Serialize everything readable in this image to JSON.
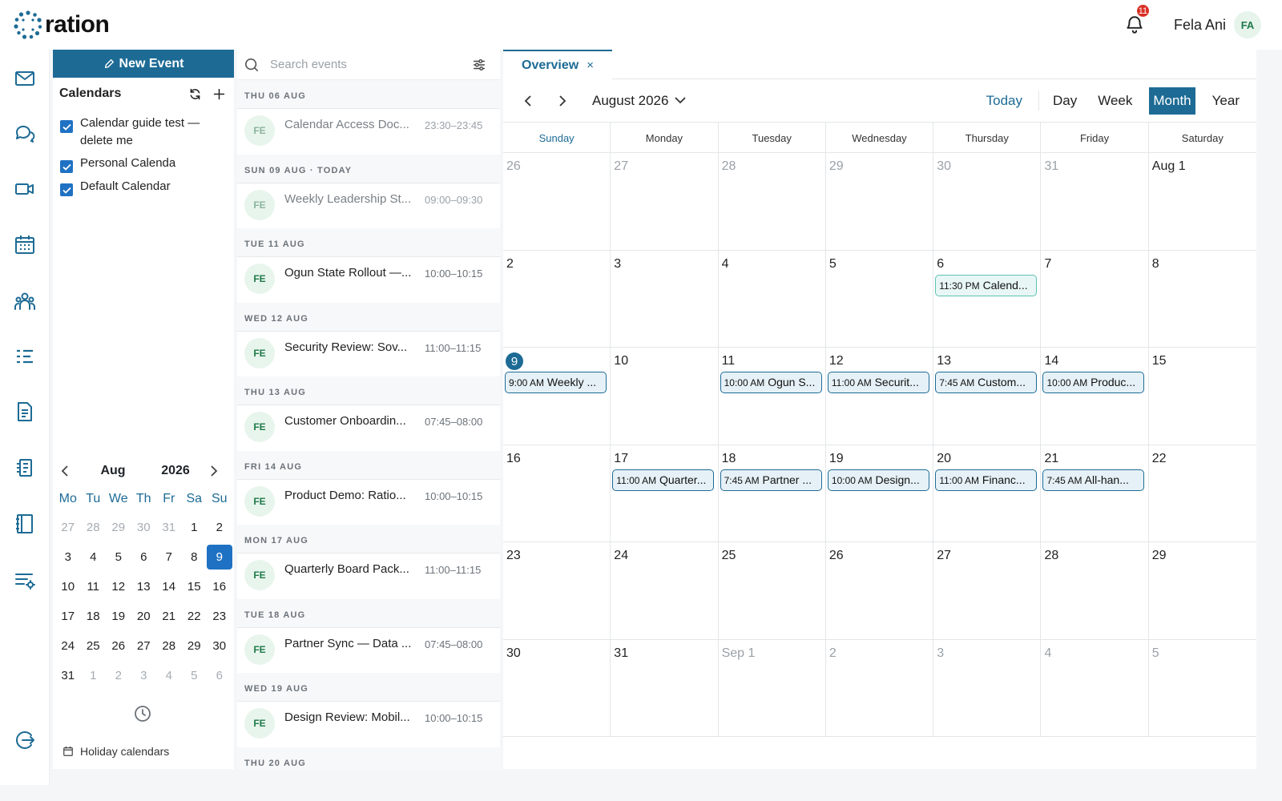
{
  "app": {
    "logo_text": "ration",
    "notifications": "11",
    "user_name": "Fela Ani",
    "user_initials": "FA"
  },
  "sidebar": {
    "new_event": "New Event",
    "calendars_title": "Calendars",
    "calendars": [
      {
        "label": "Calendar guide test — delete me",
        "checked": true
      },
      {
        "label": "Personal Calenda",
        "checked": true
      },
      {
        "label": "Default Calendar",
        "checked": true
      }
    ],
    "mini": {
      "month": "Aug",
      "year": "2026",
      "dows": [
        "Mo",
        "Tu",
        "We",
        "Th",
        "Fr",
        "Sa",
        "Su"
      ],
      "days": [
        "27",
        "28",
        "29",
        "30",
        "31",
        "1",
        "2",
        "3",
        "4",
        "5",
        "6",
        "7",
        "8",
        "9",
        "10",
        "11",
        "12",
        "13",
        "14",
        "15",
        "16",
        "17",
        "18",
        "19",
        "20",
        "21",
        "22",
        "23",
        "24",
        "25",
        "26",
        "27",
        "28",
        "29",
        "30",
        "31",
        "1",
        "2",
        "3",
        "4",
        "5",
        "6"
      ],
      "dim_before": 5,
      "dim_after_from": 36,
      "selected_index": 13
    },
    "holiday_label": "Holiday calendars"
  },
  "event_list": {
    "search_placeholder": "Search events",
    "groups": [
      {
        "date": "THU 06 AUG",
        "events": [
          {
            "avatar": "FE",
            "title": "Calendar Access Doc...",
            "time": "23:30–23:45",
            "past": true
          }
        ]
      },
      {
        "date": "SUN 09 AUG · TODAY",
        "events": [
          {
            "avatar": "FE",
            "title": "Weekly Leadership St...",
            "time": "09:00–09:30",
            "past": true
          }
        ]
      },
      {
        "date": "TUE 11 AUG",
        "events": [
          {
            "avatar": "FE",
            "title": "Ogun State Rollout —...",
            "time": "10:00–10:15",
            "past": false
          }
        ]
      },
      {
        "date": "WED 12 AUG",
        "events": [
          {
            "avatar": "FE",
            "title": "Security Review: Sov...",
            "time": "11:00–11:15",
            "past": false
          }
        ]
      },
      {
        "date": "THU 13 AUG",
        "events": [
          {
            "avatar": "FE",
            "title": "Customer Onboardin...",
            "time": "07:45–08:00",
            "past": false
          }
        ]
      },
      {
        "date": "FRI 14 AUG",
        "events": [
          {
            "avatar": "FE",
            "title": "Product Demo: Ratio...",
            "time": "10:00–10:15",
            "past": false
          }
        ]
      },
      {
        "date": "MON 17 AUG",
        "events": [
          {
            "avatar": "FE",
            "title": "Quarterly Board Pack...",
            "time": "11:00–11:15",
            "past": false
          }
        ]
      },
      {
        "date": "TUE 18 AUG",
        "events": [
          {
            "avatar": "FE",
            "title": "Partner Sync — Data ...",
            "time": "07:45–08:00",
            "past": false
          }
        ]
      },
      {
        "date": "WED 19 AUG",
        "events": [
          {
            "avatar": "FE",
            "title": "Design Review: Mobil...",
            "time": "10:00–10:15",
            "past": false
          }
        ]
      },
      {
        "date": "THU 20 AUG",
        "events": []
      }
    ]
  },
  "main": {
    "tab_label": "Overview",
    "tab_close": "×",
    "month_label": "August 2026",
    "today_label": "Today",
    "views": [
      "Day",
      "Week",
      "Month",
      "Year"
    ],
    "active_view": "Month",
    "weekdays": [
      "Sunday",
      "Monday",
      "Tuesday",
      "Wednesday",
      "Thursday",
      "Friday",
      "Saturday"
    ],
    "cells": [
      {
        "label": "26",
        "dim": true
      },
      {
        "label": "27",
        "dim": true
      },
      {
        "label": "28",
        "dim": true
      },
      {
        "label": "29",
        "dim": true
      },
      {
        "label": "30",
        "dim": true
      },
      {
        "label": "31",
        "dim": true
      },
      {
        "label": "Aug 1"
      },
      {
        "label": "2"
      },
      {
        "label": "3"
      },
      {
        "label": "4"
      },
      {
        "label": "5"
      },
      {
        "label": "6",
        "event": {
          "time": "11:30 PM",
          "title": "Calend...",
          "past": true
        }
      },
      {
        "label": "7"
      },
      {
        "label": "8"
      },
      {
        "label": "9",
        "today": true,
        "event": {
          "time": "9:00 AM",
          "title": "Weekly ..."
        }
      },
      {
        "label": "10"
      },
      {
        "label": "11",
        "event": {
          "time": "10:00 AM",
          "title": "Ogun S..."
        }
      },
      {
        "label": "12",
        "event": {
          "time": "11:00 AM",
          "title": "Securit..."
        }
      },
      {
        "label": "13",
        "event": {
          "time": "7:45 AM",
          "title": "Custom..."
        }
      },
      {
        "label": "14",
        "event": {
          "time": "10:00 AM",
          "title": "Produc..."
        }
      },
      {
        "label": "15"
      },
      {
        "label": "16"
      },
      {
        "label": "17",
        "event": {
          "time": "11:00 AM",
          "title": "Quarter..."
        }
      },
      {
        "label": "18",
        "event": {
          "time": "7:45 AM",
          "title": "Partner ..."
        }
      },
      {
        "label": "19",
        "event": {
          "time": "10:00 AM",
          "title": "Design..."
        }
      },
      {
        "label": "20",
        "event": {
          "time": "11:00 AM",
          "title": "Financ..."
        }
      },
      {
        "label": "21",
        "event": {
          "time": "7:45 AM",
          "title": "All-han..."
        }
      },
      {
        "label": "22"
      },
      {
        "label": "23"
      },
      {
        "label": "24"
      },
      {
        "label": "25"
      },
      {
        "label": "26"
      },
      {
        "label": "27"
      },
      {
        "label": "28"
      },
      {
        "label": "29"
      },
      {
        "label": "30"
      },
      {
        "label": "31"
      },
      {
        "label": "Sep 1",
        "dim": true
      },
      {
        "label": "2",
        "dim": true
      },
      {
        "label": "3",
        "dim": true
      },
      {
        "label": "4",
        "dim": true
      },
      {
        "label": "5",
        "dim": true
      }
    ]
  },
  "colors": {
    "brand": "#1d6b95",
    "checkbox": "#1f72c3",
    "badge": "#d93025"
  }
}
